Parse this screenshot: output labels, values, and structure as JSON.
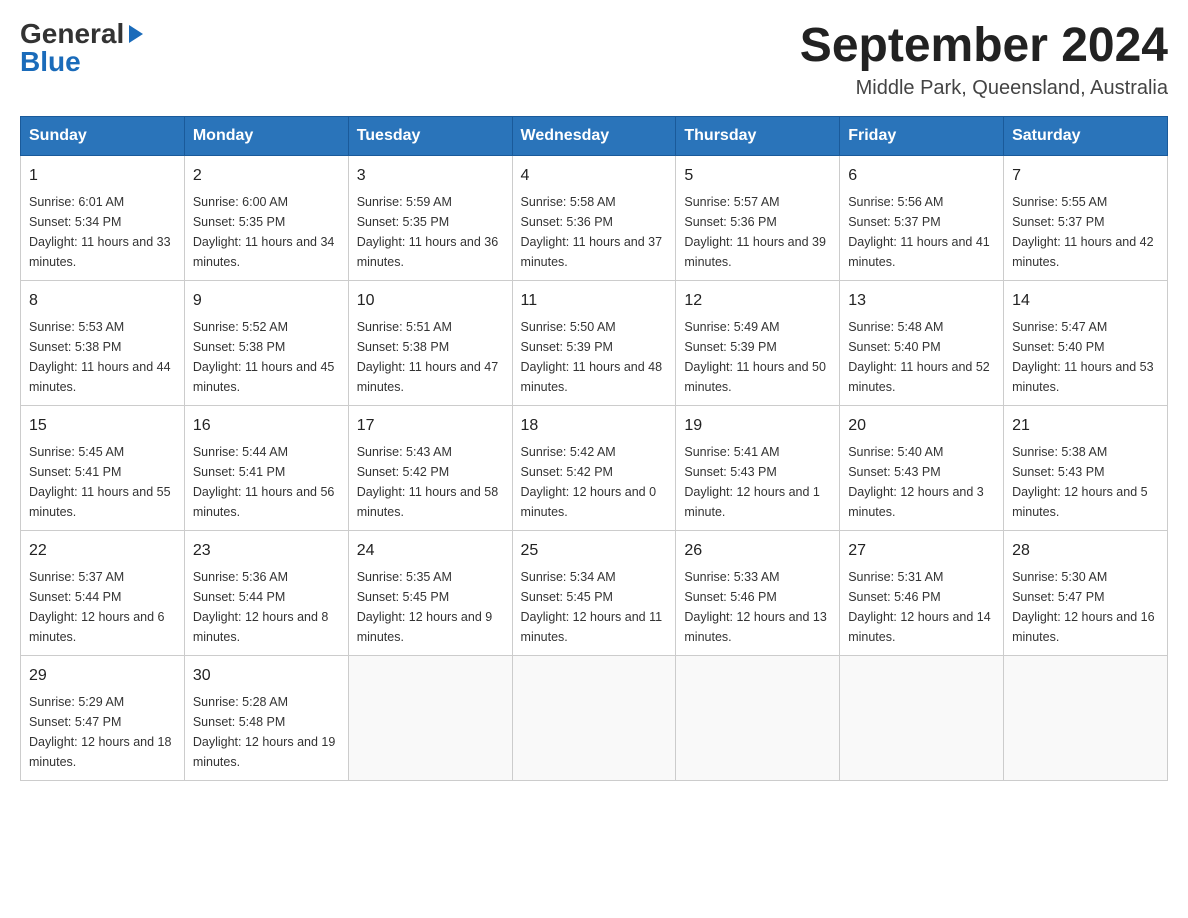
{
  "logo": {
    "general": "General",
    "blue": "Blue"
  },
  "title": {
    "month_year": "September 2024",
    "location": "Middle Park, Queensland, Australia"
  },
  "days_of_week": [
    "Sunday",
    "Monday",
    "Tuesday",
    "Wednesday",
    "Thursday",
    "Friday",
    "Saturday"
  ],
  "weeks": [
    [
      {
        "day": "1",
        "sunrise": "6:01 AM",
        "sunset": "5:34 PM",
        "daylight": "11 hours and 33 minutes."
      },
      {
        "day": "2",
        "sunrise": "6:00 AM",
        "sunset": "5:35 PM",
        "daylight": "11 hours and 34 minutes."
      },
      {
        "day": "3",
        "sunrise": "5:59 AM",
        "sunset": "5:35 PM",
        "daylight": "11 hours and 36 minutes."
      },
      {
        "day": "4",
        "sunrise": "5:58 AM",
        "sunset": "5:36 PM",
        "daylight": "11 hours and 37 minutes."
      },
      {
        "day": "5",
        "sunrise": "5:57 AM",
        "sunset": "5:36 PM",
        "daylight": "11 hours and 39 minutes."
      },
      {
        "day": "6",
        "sunrise": "5:56 AM",
        "sunset": "5:37 PM",
        "daylight": "11 hours and 41 minutes."
      },
      {
        "day": "7",
        "sunrise": "5:55 AM",
        "sunset": "5:37 PM",
        "daylight": "11 hours and 42 minutes."
      }
    ],
    [
      {
        "day": "8",
        "sunrise": "5:53 AM",
        "sunset": "5:38 PM",
        "daylight": "11 hours and 44 minutes."
      },
      {
        "day": "9",
        "sunrise": "5:52 AM",
        "sunset": "5:38 PM",
        "daylight": "11 hours and 45 minutes."
      },
      {
        "day": "10",
        "sunrise": "5:51 AM",
        "sunset": "5:38 PM",
        "daylight": "11 hours and 47 minutes."
      },
      {
        "day": "11",
        "sunrise": "5:50 AM",
        "sunset": "5:39 PM",
        "daylight": "11 hours and 48 minutes."
      },
      {
        "day": "12",
        "sunrise": "5:49 AM",
        "sunset": "5:39 PM",
        "daylight": "11 hours and 50 minutes."
      },
      {
        "day": "13",
        "sunrise": "5:48 AM",
        "sunset": "5:40 PM",
        "daylight": "11 hours and 52 minutes."
      },
      {
        "day": "14",
        "sunrise": "5:47 AM",
        "sunset": "5:40 PM",
        "daylight": "11 hours and 53 minutes."
      }
    ],
    [
      {
        "day": "15",
        "sunrise": "5:45 AM",
        "sunset": "5:41 PM",
        "daylight": "11 hours and 55 minutes."
      },
      {
        "day": "16",
        "sunrise": "5:44 AM",
        "sunset": "5:41 PM",
        "daylight": "11 hours and 56 minutes."
      },
      {
        "day": "17",
        "sunrise": "5:43 AM",
        "sunset": "5:42 PM",
        "daylight": "11 hours and 58 minutes."
      },
      {
        "day": "18",
        "sunrise": "5:42 AM",
        "sunset": "5:42 PM",
        "daylight": "12 hours and 0 minutes."
      },
      {
        "day": "19",
        "sunrise": "5:41 AM",
        "sunset": "5:43 PM",
        "daylight": "12 hours and 1 minute."
      },
      {
        "day": "20",
        "sunrise": "5:40 AM",
        "sunset": "5:43 PM",
        "daylight": "12 hours and 3 minutes."
      },
      {
        "day": "21",
        "sunrise": "5:38 AM",
        "sunset": "5:43 PM",
        "daylight": "12 hours and 5 minutes."
      }
    ],
    [
      {
        "day": "22",
        "sunrise": "5:37 AM",
        "sunset": "5:44 PM",
        "daylight": "12 hours and 6 minutes."
      },
      {
        "day": "23",
        "sunrise": "5:36 AM",
        "sunset": "5:44 PM",
        "daylight": "12 hours and 8 minutes."
      },
      {
        "day": "24",
        "sunrise": "5:35 AM",
        "sunset": "5:45 PM",
        "daylight": "12 hours and 9 minutes."
      },
      {
        "day": "25",
        "sunrise": "5:34 AM",
        "sunset": "5:45 PM",
        "daylight": "12 hours and 11 minutes."
      },
      {
        "day": "26",
        "sunrise": "5:33 AM",
        "sunset": "5:46 PM",
        "daylight": "12 hours and 13 minutes."
      },
      {
        "day": "27",
        "sunrise": "5:31 AM",
        "sunset": "5:46 PM",
        "daylight": "12 hours and 14 minutes."
      },
      {
        "day": "28",
        "sunrise": "5:30 AM",
        "sunset": "5:47 PM",
        "daylight": "12 hours and 16 minutes."
      }
    ],
    [
      {
        "day": "29",
        "sunrise": "5:29 AM",
        "sunset": "5:47 PM",
        "daylight": "12 hours and 18 minutes."
      },
      {
        "day": "30",
        "sunrise": "5:28 AM",
        "sunset": "5:48 PM",
        "daylight": "12 hours and 19 minutes."
      },
      null,
      null,
      null,
      null,
      null
    ]
  ]
}
